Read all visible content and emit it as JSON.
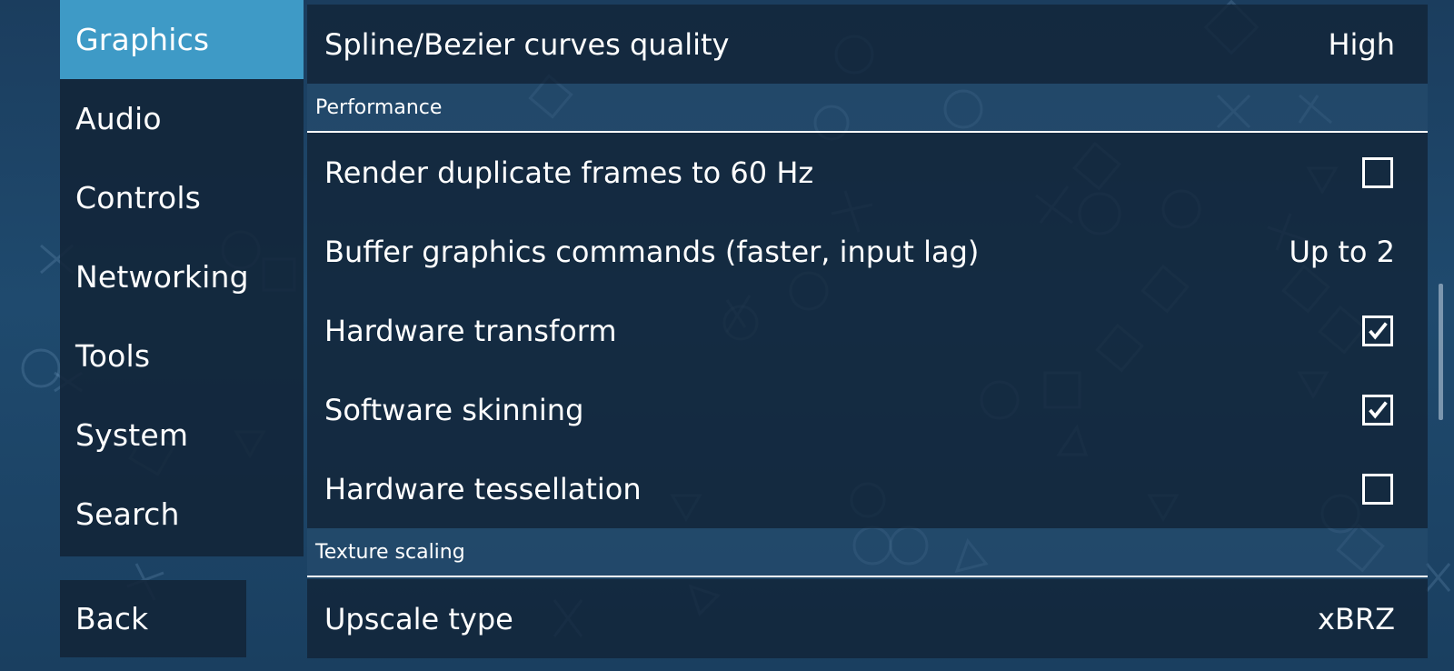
{
  "sidebar": {
    "tabs": [
      {
        "label": "Graphics",
        "active": true
      },
      {
        "label": "Audio",
        "active": false
      },
      {
        "label": "Controls",
        "active": false
      },
      {
        "label": "Networking",
        "active": false
      },
      {
        "label": "Tools",
        "active": false
      },
      {
        "label": "System",
        "active": false
      },
      {
        "label": "Search",
        "active": false
      }
    ],
    "back_label": "Back"
  },
  "settings": {
    "spline_quality": {
      "label": "Spline/Bezier curves quality",
      "value": "High"
    },
    "performance_header": "Performance",
    "render_duplicate": {
      "label": "Render duplicate frames to 60 Hz",
      "checked": false
    },
    "buffer_commands": {
      "label": "Buffer graphics commands (faster, input lag)",
      "value": "Up to 2"
    },
    "hardware_transform": {
      "label": "Hardware transform",
      "checked": true
    },
    "software_skinning": {
      "label": "Software skinning",
      "checked": true
    },
    "hardware_tessellation": {
      "label": "Hardware tessellation",
      "checked": false
    },
    "texture_scaling_header": "Texture scaling",
    "upscale_type": {
      "label": "Upscale type",
      "value": "xBRZ"
    }
  },
  "colors": {
    "accent": "#3e9ac6",
    "panel": "#122438",
    "background": "#1f4a6e"
  }
}
